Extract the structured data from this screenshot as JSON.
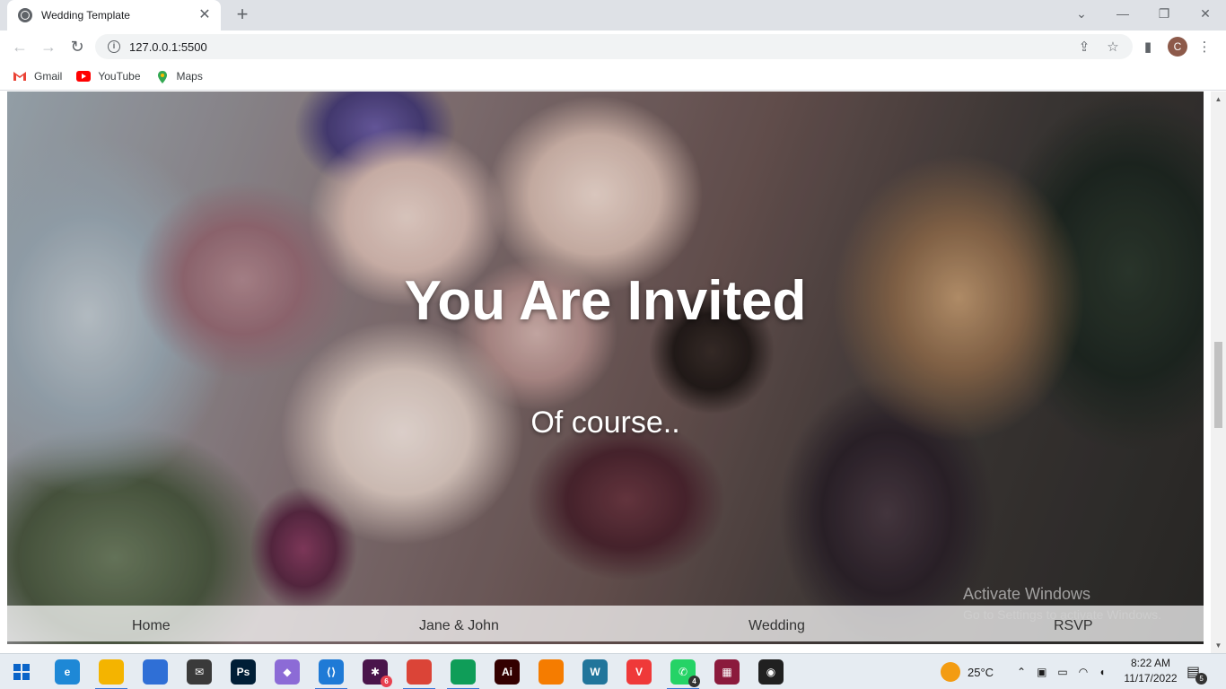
{
  "browser": {
    "tab_title": "Wedding Template",
    "tab_close": "✕",
    "new_tab": "+",
    "url": "127.0.0.1:5500",
    "profile_initial": "C",
    "bookmarks": [
      {
        "label": "Gmail",
        "icon": "gmail-icon",
        "color": "#ea4335"
      },
      {
        "label": "YouTube",
        "icon": "youtube-icon",
        "color": "#ff0000"
      },
      {
        "label": "Maps",
        "icon": "maps-icon",
        "color": "#34a853"
      }
    ]
  },
  "page": {
    "hero_title": "You Are Invited",
    "hero_subtitle": "Of course..",
    "nav": [
      "Home",
      "Jane & John",
      "Wedding",
      "RSVP"
    ]
  },
  "watermark": {
    "line1": "Activate Windows",
    "line2": "Go to Settings to activate Windows."
  },
  "taskbar": {
    "apps": [
      {
        "name": "edge",
        "label": "e",
        "color": "#1e88d6"
      },
      {
        "name": "file-explorer",
        "label": "",
        "color": "#f4b400"
      },
      {
        "name": "microsoft-store",
        "label": "",
        "color": "#2f6fd6"
      },
      {
        "name": "mail",
        "label": "✉",
        "color": "#3a3a3a"
      },
      {
        "name": "photoshop",
        "label": "Ps",
        "color": "#001e36"
      },
      {
        "name": "git",
        "label": "◆",
        "color": "#8c6bd6"
      },
      {
        "name": "vscode",
        "label": "⟨⟩",
        "color": "#1f7ad6"
      },
      {
        "name": "slack",
        "label": "✱",
        "color": "#4a154b",
        "badge": "6"
      },
      {
        "name": "chrome-profile",
        "label": "",
        "color": "#db4437"
      },
      {
        "name": "chrome",
        "label": "",
        "color": "#0f9d58"
      },
      {
        "name": "illustrator",
        "label": "Ai",
        "color": "#330000"
      },
      {
        "name": "fl-studio",
        "label": "",
        "color": "#f57c00"
      },
      {
        "name": "wordpress",
        "label": "W",
        "color": "#21759b"
      },
      {
        "name": "vivaldi",
        "label": "V",
        "color": "#ef3939"
      },
      {
        "name": "whatsapp",
        "label": "✆",
        "color": "#25d366",
        "badge": "4"
      },
      {
        "name": "winrar",
        "label": "▦",
        "color": "#8b1a3c"
      },
      {
        "name": "obs",
        "label": "◉",
        "color": "#202020"
      }
    ],
    "temperature": "25°C",
    "time": "8:22 AM",
    "date": "11/17/2022",
    "notifications": "5"
  }
}
